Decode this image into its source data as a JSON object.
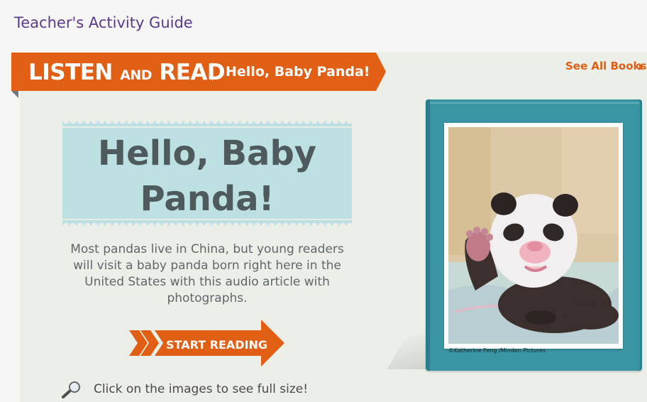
{
  "header": {
    "guide_title": "Teacher's Activity Guide"
  },
  "banner": {
    "brand_listen": "LISTEN",
    "brand_and": "AND",
    "brand_read": "READ",
    "book_title": "Hello, Baby Panda!",
    "see_all_label": "See All Books"
  },
  "main": {
    "title_line1": "Hello, Baby",
    "title_line2": "Panda!",
    "description": "Most pandas live in China, but young readers will visit a baby panda born right here in the United States with this audio article with photographs.",
    "start_label": "START READING",
    "hint": "Click on the images to see full size!"
  },
  "cover": {
    "credit": "©Katherine Feng /Minden Pictures"
  },
  "colors": {
    "brand_orange": "#e05f14",
    "title_card": "#bde0e2",
    "book_teal": "#3a95a3",
    "guide_purple": "#5b3a8e"
  },
  "icons": {
    "zoom": "magnifier-icon",
    "see_all_arrow": "triangle-right-icon"
  }
}
